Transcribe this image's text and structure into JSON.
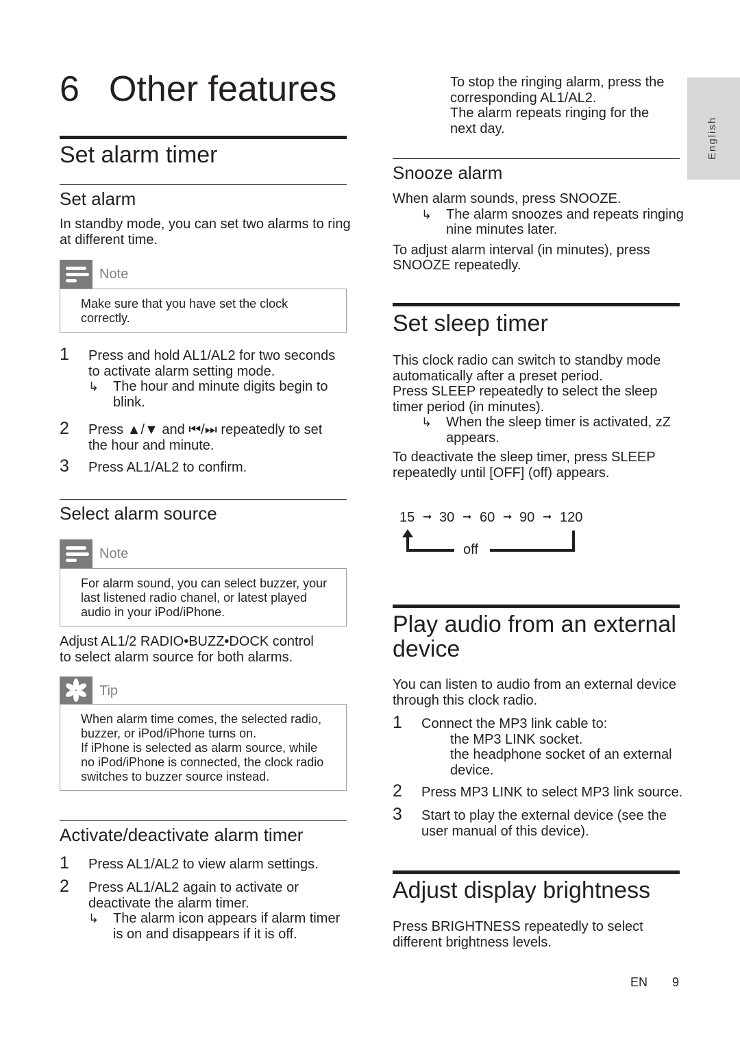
{
  "chapter": {
    "number": "6",
    "title": "Other features"
  },
  "language_tab": "English",
  "set_alarm_timer": {
    "heading": "Set alarm timer",
    "set_alarm": {
      "heading": "Set alarm",
      "intro": "In standby mode, you can set two alarms to ring at different time.",
      "note": {
        "label": "Note",
        "lines": [
          "Make sure that you have set the clock",
          "correctly."
        ]
      },
      "steps": [
        {
          "num": "1",
          "lines": [
            "Press and hold AL1/AL2 for two seconds",
            "to activate alarm setting mode."
          ],
          "result": [
            "The hour and minute digits begin to",
            "blink."
          ]
        },
        {
          "num": "2",
          "lines": [
            "Press ▲/▼ and ⏮/⏭ repeatedly to set",
            "the hour and minute."
          ]
        },
        {
          "num": "3",
          "lines": [
            "Press AL1/AL2 to confirm."
          ]
        }
      ]
    },
    "select_source": {
      "heading": "Select alarm source",
      "note": {
        "label": "Note",
        "lines": [
          "For alarm sound, you can select buzzer, your",
          "last listened radio chanel, or latest played",
          "audio in your iPod/iPhone."
        ]
      },
      "body": [
        "Adjust AL1/2 RADIO•BUZZ•DOCK control",
        "to select alarm source for both alarms."
      ],
      "tip": {
        "label": "Tip",
        "lines": [
          "When alarm time comes, the selected radio,",
          "buzzer, or iPod/iPhone turns on.",
          "If iPhone is selected as alarm source, while",
          "no iPod/iPhone is connected, the clock radio",
          "switches to buzzer source instead."
        ]
      }
    },
    "activate": {
      "heading": "Activate/deactivate alarm timer",
      "steps": [
        {
          "num": "1",
          "lines": [
            "Press AL1/AL2 to view alarm settings."
          ]
        },
        {
          "num": "2",
          "lines": [
            "Press AL1/AL2 again to activate or",
            "deactivate the alarm timer."
          ],
          "result": [
            "The alarm icon appears if alarm timer",
            "is on and disappears if it is off."
          ]
        }
      ]
    },
    "stop_ringing": [
      "To stop the ringing alarm, press the",
      "corresponding AL1/AL2.",
      "The alarm repeats ringing for the",
      "next day."
    ]
  },
  "snooze": {
    "heading": "Snooze alarm",
    "line1": "When alarm sounds, press SNOOZE.",
    "result": [
      "The alarm snoozes and repeats ringing",
      "nine minutes later."
    ],
    "body": [
      "To adjust alarm interval (in minutes), press",
      "SNOOZE repeatedly."
    ]
  },
  "sleep": {
    "heading": "Set sleep timer",
    "body": [
      "This clock radio can switch to standby mode",
      "automatically after a preset period.",
      "Press SLEEP repeatedly to select the sleep",
      "timer period (in minutes)."
    ],
    "result": [
      "When the sleep timer is activated, zZ",
      "appears."
    ],
    "deactivate": [
      "To deactivate the sleep timer, press SLEEP",
      "repeatedly until [OFF] (off) appears."
    ],
    "sequence": [
      "15",
      "30",
      "60",
      "90",
      "120"
    ],
    "sequence_off": "off"
  },
  "external": {
    "heading_lines": [
      "Play audio from an external",
      "device"
    ],
    "intro": [
      "You can listen to audio from an external device",
      "through this clock radio."
    ],
    "steps": [
      {
        "num": "1",
        "lines": [
          "Connect the MP3 link cable to:"
        ],
        "sub": [
          "the MP3 LINK socket.",
          "the headphone socket of an external",
          "device."
        ]
      },
      {
        "num": "2",
        "lines": [
          "Press MP3 LINK to select MP3 link source."
        ]
      },
      {
        "num": "3",
        "lines": [
          "Start to play the external device (see the",
          "user manual of this device)."
        ]
      }
    ]
  },
  "brightness": {
    "heading": "Adjust display brightness",
    "body": [
      "Press BRIGHTNESS repeatedly to select",
      "different brightness levels."
    ]
  },
  "footer": {
    "lang": "EN",
    "page": "9"
  }
}
